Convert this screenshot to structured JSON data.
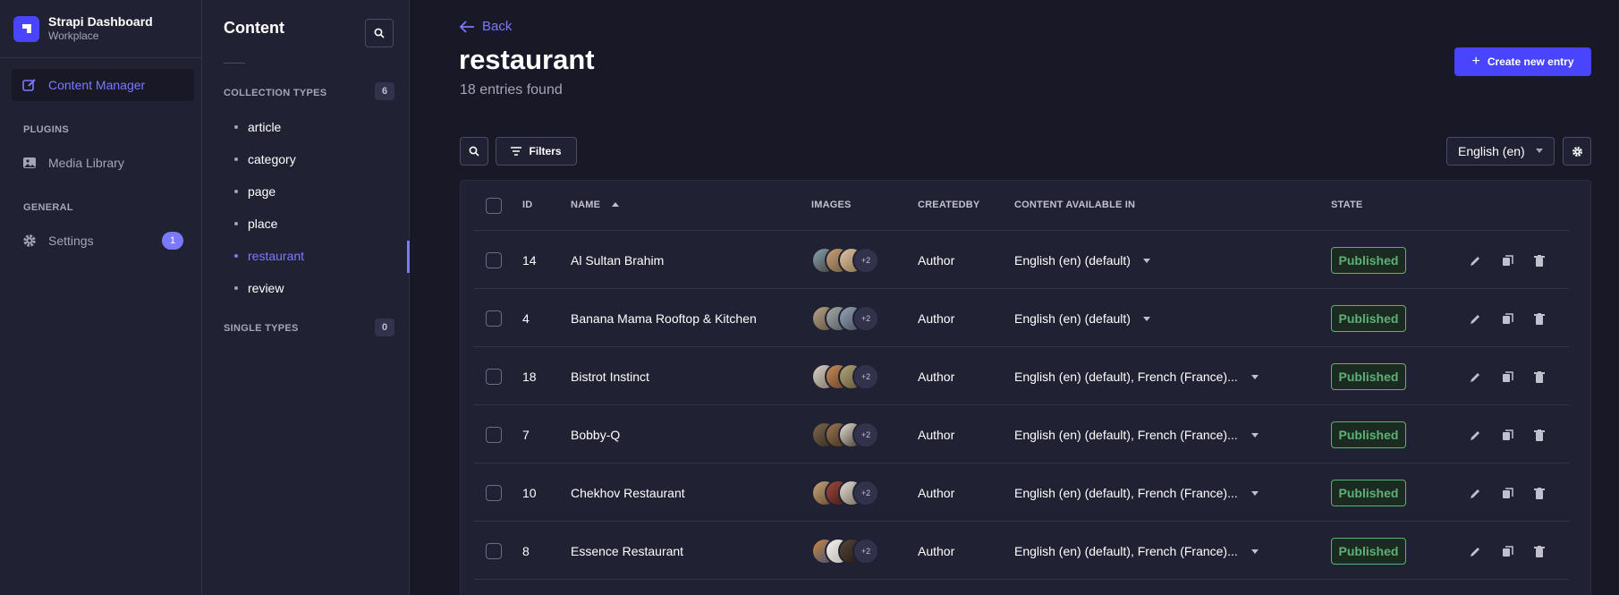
{
  "brand": {
    "title": "Strapi Dashboard",
    "subtitle": "Workplace"
  },
  "mainnav": {
    "content_manager": "Content Manager",
    "plugins_label": "PLUGINS",
    "media_library": "Media Library",
    "general_label": "GENERAL",
    "settings": "Settings",
    "settings_badge": "1"
  },
  "subnav": {
    "title": "Content",
    "collection_types_label": "COLLECTION TYPES",
    "collection_count": "6",
    "collection_types": [
      "article",
      "category",
      "page",
      "place",
      "restaurant",
      "review"
    ],
    "active_type": "restaurant",
    "single_types_label": "SINGLE TYPES",
    "single_count": "0"
  },
  "header": {
    "back": "Back",
    "title": "restaurant",
    "subtitle": "18 entries found",
    "create_button": "Create new entry"
  },
  "toolbar": {
    "filters": "Filters",
    "locale": "English (en)"
  },
  "table": {
    "headers": {
      "id": "ID",
      "name": "NAME",
      "images": "IMAGES",
      "createdby": "CREATEDBY",
      "content_available": "CONTENT AVAILABLE IN",
      "state": "STATE"
    },
    "rows": [
      {
        "id": "14",
        "name": "Al Sultan Brahim",
        "more_images": "+2",
        "createdby": "Author",
        "locales": "English (en) (default)",
        "state": "Published"
      },
      {
        "id": "4",
        "name": "Banana Mama Rooftop & Kitchen",
        "more_images": "+2",
        "createdby": "Author",
        "locales": "English (en) (default)",
        "state": "Published"
      },
      {
        "id": "18",
        "name": "Bistrot Instinct",
        "more_images": "+2",
        "createdby": "Author",
        "locales": "English (en) (default), French (France)...",
        "state": "Published"
      },
      {
        "id": "7",
        "name": "Bobby-Q",
        "more_images": "+2",
        "createdby": "Author",
        "locales": "English (en) (default), French (France)...",
        "state": "Published"
      },
      {
        "id": "10",
        "name": "Chekhov Restaurant",
        "more_images": "+2",
        "createdby": "Author",
        "locales": "English (en) (default), French (France)...",
        "state": "Published"
      },
      {
        "id": "8",
        "name": "Essence Restaurant",
        "more_images": "+2",
        "createdby": "Author",
        "locales": "English (en) (default), French (France)...",
        "state": "Published"
      }
    ]
  },
  "colors": {
    "accent": "#7b79ff",
    "primary": "#4945ff",
    "published": "#5cb176",
    "bg": "#181826",
    "panel": "#212134"
  }
}
